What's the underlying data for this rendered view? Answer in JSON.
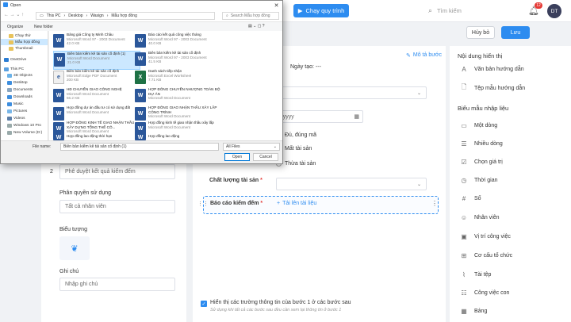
{
  "topbar": {
    "run_label": "Chạy quy trình",
    "search_placeholder": "Tìm kiếm",
    "notif_count": "12",
    "avatar_initials": "DT"
  },
  "actions": {
    "cancel": "Hủy bỏ",
    "save": "Lưu"
  },
  "left": {
    "step_num": "2",
    "step_value": "Phê duyệt kết quả kiểm đếm",
    "perm_label": "Phân quyền sử dụng",
    "perm_value": "Tất cả nhân viên",
    "icon_label": "Biểu tượng",
    "note_label": "Ghi chú",
    "note_placeholder": "Nhập ghi chú"
  },
  "mid": {
    "desc_link": "Mô tả bước",
    "created_label": "Ngày tạo:",
    "created_value": "---",
    "date_placeholder": "m/yyyy",
    "radio_ok": "Đủ, đúng mã",
    "radio_missing": "Mất tài sản",
    "radio_excess": "Thừa tài sản",
    "quality_label": "Chất lượng tài sản",
    "report_label": "Báo cáo kiểm đếm",
    "upload_link": "Tải lên tài liệu",
    "show_fields_label": "Hiển thị các trường thông tin của bước 1 ở các bước sau",
    "show_fields_hint": "Sử dụng khi tất cả các bước sau đều cần xem lại thông tin ở bước 1"
  },
  "right": {
    "display_title": "Nội dung hiển thị",
    "display_items": [
      "Văn bản hướng dẫn",
      "Tệp mẫu hướng dẫn"
    ],
    "form_title": "Biểu mẫu nhập liệu",
    "form_items": [
      "Một dòng",
      "Nhiều dòng",
      "Chọn giá trị",
      "Thời gian",
      "Số",
      "Nhân viên",
      "Vị trí công việc",
      "Cơ cấu tổ chức",
      "Tài tệp",
      "Công việc con",
      "Bảng"
    ]
  },
  "dialog": {
    "title": "Open",
    "path": [
      "This PC",
      "Desktop",
      "Wasign",
      "Mẫu hợp đồng"
    ],
    "search_placeholder": "Search Mẫu hợp đồng",
    "organize": "Organize",
    "new_folder": "New folder",
    "nav": [
      "Chạy thử",
      "Mẫu hợp đồng",
      "Thumbnail",
      "OneDrive",
      "This PC",
      "3D Objects",
      "Desktop",
      "Documents",
      "Downloads",
      "Music",
      "Pictures",
      "Videos",
      "Windows 10 Pro",
      "New Volume (D:)"
    ],
    "files": [
      {
        "name": "Bảng giá Công ty Minh Châu",
        "type": "Microsoft Word 97 - 2003 Document",
        "size": "42.0 KB",
        "icon": "w"
      },
      {
        "name": "Báo cáo kết quả công việc tháng",
        "type": "Microsoft Word 97 - 2003 Document",
        "size": "40.0 KB",
        "icon": "w"
      },
      {
        "name": "Biên bản kiểm kê tài sản cố định (1)",
        "type": "Microsoft Word Document",
        "size": "21.0 KB",
        "icon": "w"
      },
      {
        "name": "Biên bản kiểm kê tài sản cố định",
        "type": "Microsoft Word 97 - 2003 Document",
        "size": "41.5 KB",
        "icon": "w"
      },
      {
        "name": "Biên bản kiểm kê tài sản cố định",
        "type": "Microsoft Edge PDF Document",
        "size": "200 KB",
        "icon": "pdf"
      },
      {
        "name": "Danh sách tiếp nhận",
        "type": "Microsoft Excel Worksheet",
        "size": "7.71 KB",
        "icon": "x"
      },
      {
        "name": "HĐ CHUYỂN GIAO CÔNG NGHỆ",
        "type": "Microsoft Word Document",
        "size": "56.2 KB",
        "icon": "w"
      },
      {
        "name": "HỢP ĐỒNG CHUYỂN NHƯỢNG TOÀN BỘ DỰ ÁN",
        "type": "Microsoft Word Document",
        "size": "",
        "icon": "w"
      },
      {
        "name": "Hợp đồng dự án đầu tư có sử dụng đất",
        "type": "Microsoft Word Document",
        "size": "",
        "icon": "w"
      },
      {
        "name": "HỢP ĐỒNG GIAO NHẬN THẦU XÂY LẮP CÔNG TRÌNH",
        "type": "Microsoft Word Document",
        "size": "",
        "icon": "w"
      },
      {
        "name": "HỢP ĐỒNG KINH TẾ GIAO NHẬN THẦU XÂY DỰNG TỔNG THỂ CÔ...",
        "type": "Microsoft Word Document",
        "size": "",
        "icon": "w"
      },
      {
        "name": "Hợp đồng kinh tế giao nhận thầu xây lắp",
        "type": "Microsoft Word Document",
        "size": "",
        "icon": "w"
      },
      {
        "name": "Hợp đồng lao động thời hạn",
        "type": "",
        "size": "",
        "icon": "w"
      },
      {
        "name": "Hợp đồng lao động",
        "type": "",
        "size": "",
        "icon": "w"
      }
    ],
    "filename_label": "File name:",
    "filename_value": "Biên bản kiểm kê tài sản cố định (1)",
    "filetype": "All Files",
    "open": "Open",
    "cancel": "Cancel"
  }
}
